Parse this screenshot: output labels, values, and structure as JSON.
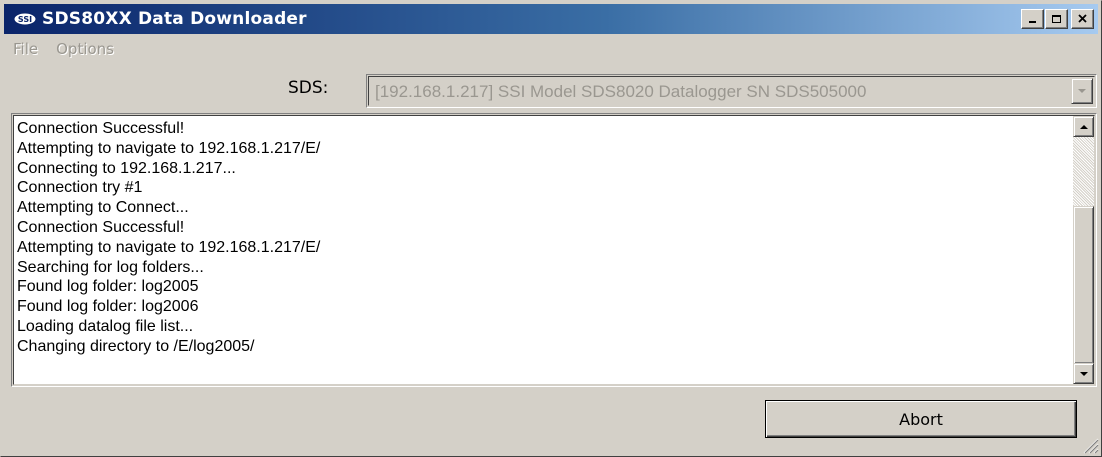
{
  "window": {
    "title": "SDS80XX Data Downloader",
    "icon": "ssi-logo-icon"
  },
  "menu": {
    "items": [
      {
        "label": "File"
      },
      {
        "label": "Options"
      }
    ]
  },
  "sds": {
    "label": "SDS:",
    "selected": "[192.168.1.217] SSI Model SDS8020 Datalogger SN SDS505000"
  },
  "log": {
    "lines": [
      "Connection Successful!",
      "Attempting to navigate to 192.168.1.217/E/",
      "Connecting to 192.168.1.217...",
      "Connection try #1",
      "Attempting to Connect...",
      "Connection Successful!",
      "Attempting to navigate to 192.168.1.217/E/",
      "Searching for log folders...",
      "Found log folder: log2005",
      "Found log folder: log2006",
      "Loading datalog file list...",
      "Changing directory to /E/log2005/"
    ]
  },
  "actions": {
    "abort_label": "Abort"
  },
  "colors": {
    "titlebar_start": "#0a246a",
    "titlebar_end": "#a6caf0",
    "face": "#d4d0c8",
    "disabled_text": "#9a9790"
  }
}
